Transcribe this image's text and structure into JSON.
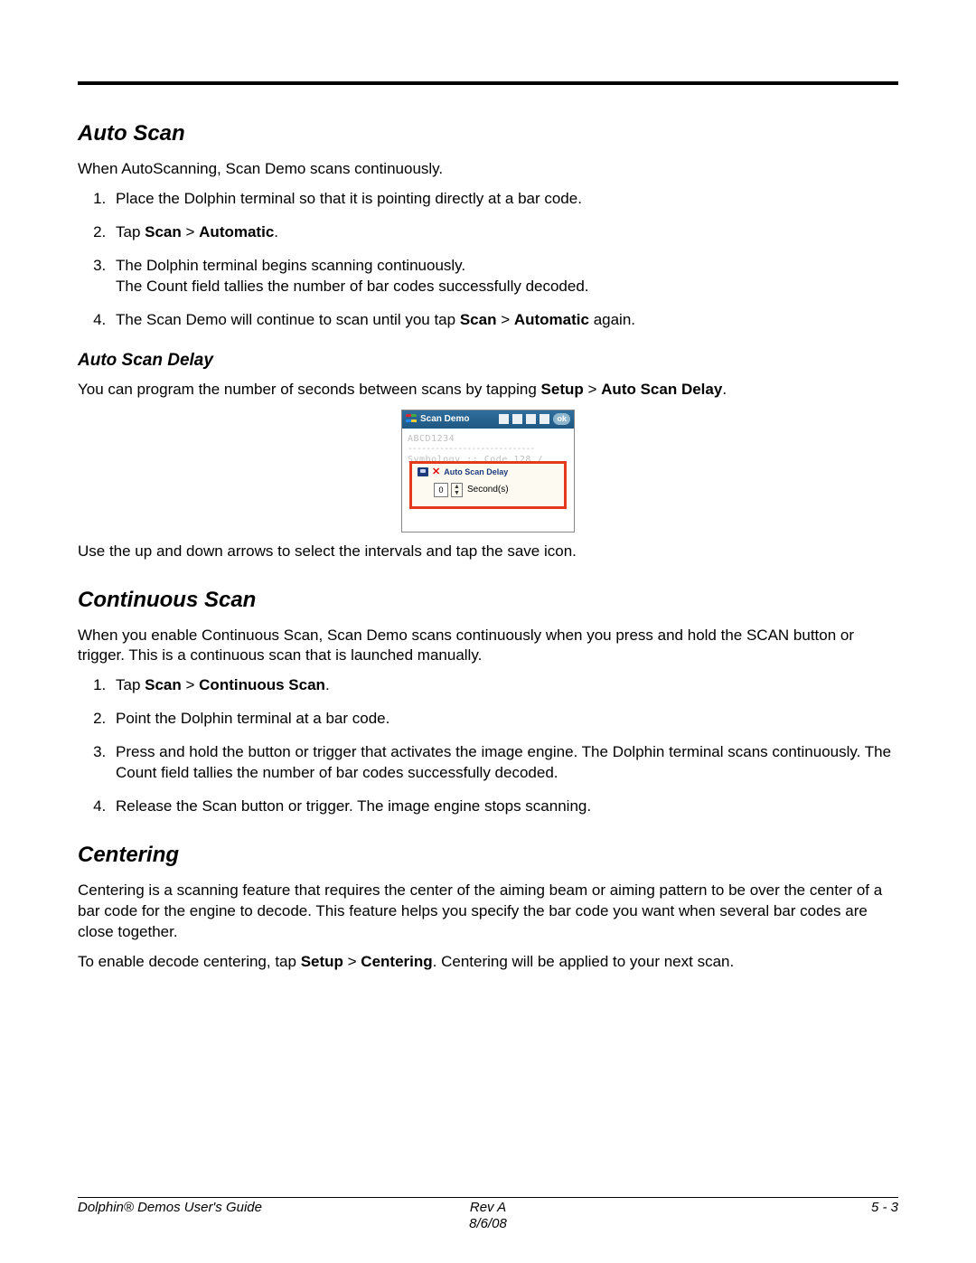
{
  "sections": {
    "autoscan": {
      "heading": "Auto Scan",
      "intro": "When AutoScanning, Scan Demo scans continuously.",
      "steps": [
        {
          "text": "Place the Dolphin terminal so that it is pointing directly at a bar code."
        },
        {
          "prefix": "Tap ",
          "bold1": "Scan",
          "mid": " > ",
          "bold2": "Automatic",
          "suffix": "."
        },
        {
          "text": "The Dolphin terminal begins scanning continuously.",
          "sub": "The Count field tallies the number of bar codes successfully decoded."
        },
        {
          "prefix": "The Scan Demo will continue to scan until you tap ",
          "bold1": "Scan",
          "mid": " > ",
          "bold2": "Automatic",
          "suffix": " again."
        }
      ]
    },
    "delay": {
      "heading": "Auto Scan Delay",
      "para_prefix": "You can program the number of seconds between scans by tapping ",
      "bold1": "Setup",
      "mid": " > ",
      "bold2": "Auto Scan Delay",
      "suffix": ".",
      "below": "Use the up and down arrows to select the intervals and tap the save icon."
    },
    "screenshot": {
      "title": "Scan Demo",
      "ok": "ok",
      "faint1": "ABCD1234",
      "faint_dashes": "----------------------------",
      "faint2": "Symbology :: Code 128 /",
      "dialog_title": "Auto Scan Delay",
      "value": "0",
      "seconds_label": "Second(s)"
    },
    "continuous": {
      "heading": "Continuous Scan",
      "intro": "When you enable Continuous Scan, Scan Demo scans continuously when you press and hold the SCAN button or trigger. This is a continuous scan that is launched manually.",
      "steps": [
        {
          "prefix": "Tap ",
          "bold1": "Scan",
          "mid": " > ",
          "bold2": "Continuous Scan",
          "suffix": "."
        },
        {
          "text": "Point the Dolphin terminal at a bar code."
        },
        {
          "text": "Press and hold the button or trigger that activates the image engine. The Dolphin terminal scans continuously. The Count field tallies the number of bar codes successfully decoded."
        },
        {
          "text": "Release the Scan button or trigger. The image engine stops scanning."
        }
      ]
    },
    "centering": {
      "heading": "Centering",
      "para1": "Centering is a scanning feature that requires the center of the aiming beam or aiming pattern to be over the center of a bar code for the engine to decode. This feature helps you specify the bar code you want when several bar codes are close together.",
      "para2_prefix": "To enable decode centering, tap ",
      "bold1": "Setup",
      "mid": " > ",
      "bold2": "Centering",
      "para2_suffix": ". Centering will be applied to your next scan."
    }
  },
  "footer": {
    "left": "Dolphin® Demos User's Guide",
    "rev": "Rev A",
    "date": "8/6/08",
    "page": "5 - 3"
  }
}
